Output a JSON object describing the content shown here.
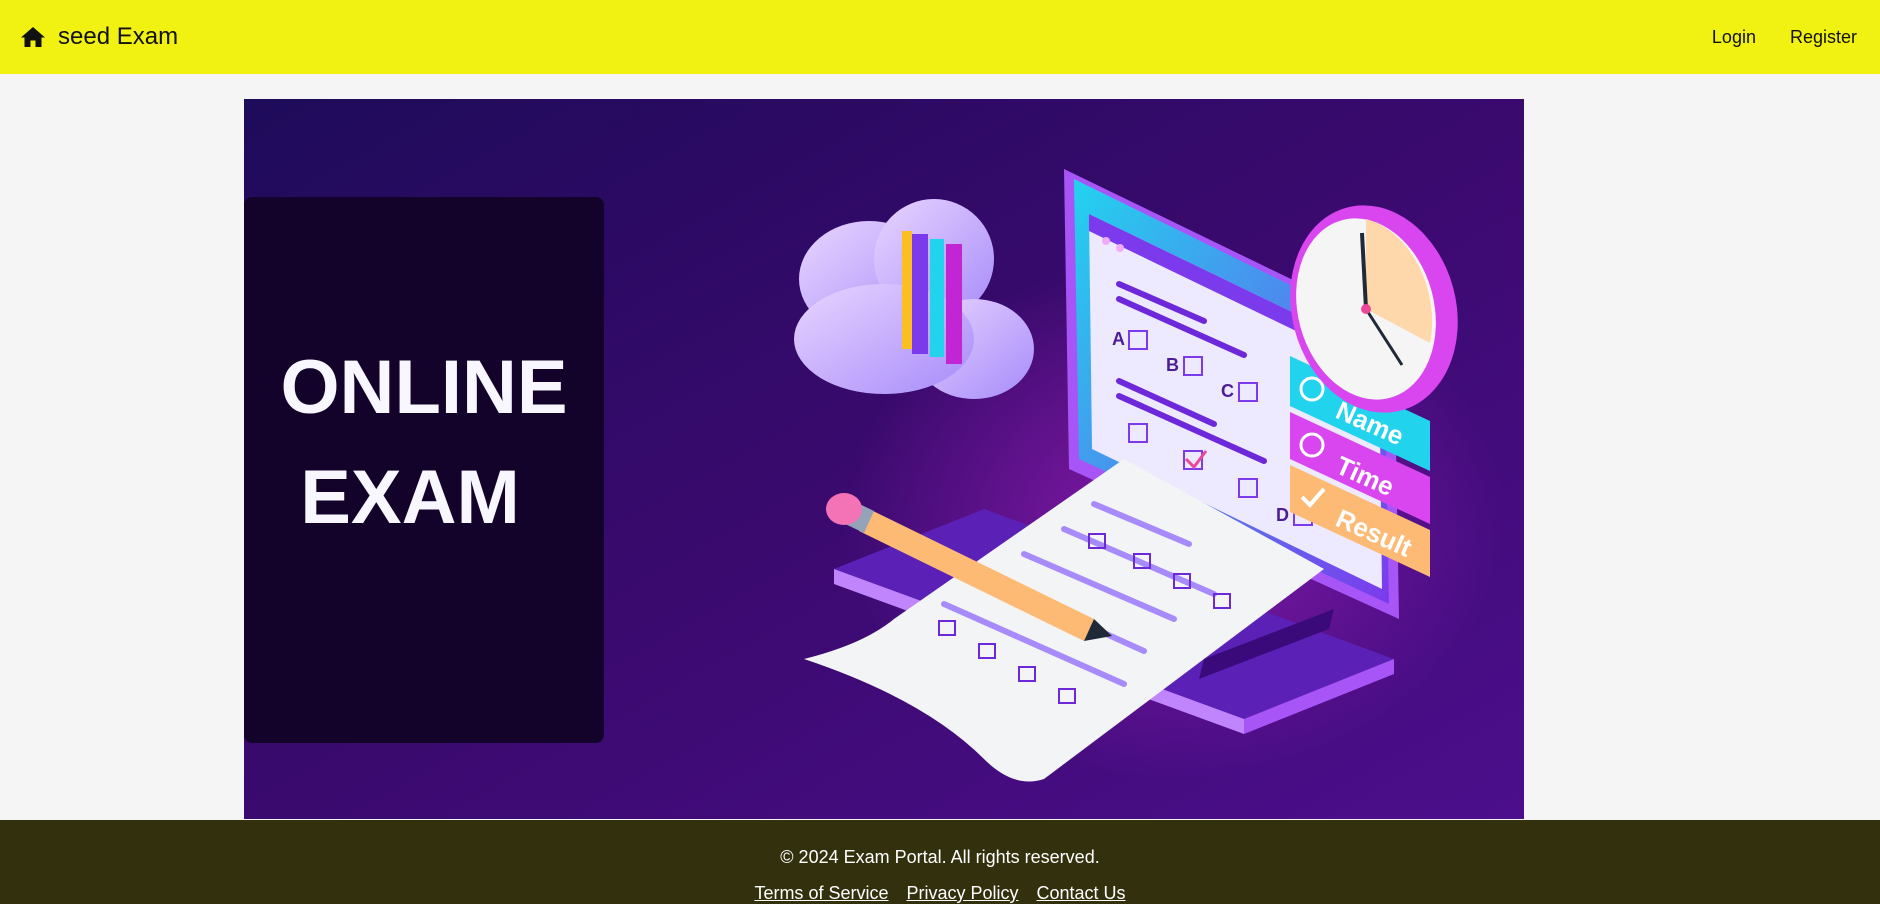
{
  "header": {
    "brand_icon": "home-icon",
    "title": "seed Exam",
    "nav": [
      {
        "label": "Login"
      },
      {
        "label": "Register"
      }
    ],
    "background_color": "#f2f212"
  },
  "hero": {
    "headline_line1": "ONLINE",
    "headline_line2": "EXAM",
    "form_labels": [
      "A",
      "B",
      "C",
      "D"
    ],
    "card_labels": [
      "Name",
      "Time",
      "Result"
    ]
  },
  "footer": {
    "copyright": "© 2024 Exam Portal. All rights reserved.",
    "links": [
      {
        "label": "Terms of Service"
      },
      {
        "label": "Privacy Policy"
      },
      {
        "label": "Contact Us"
      }
    ],
    "background_color": "#33300e"
  }
}
